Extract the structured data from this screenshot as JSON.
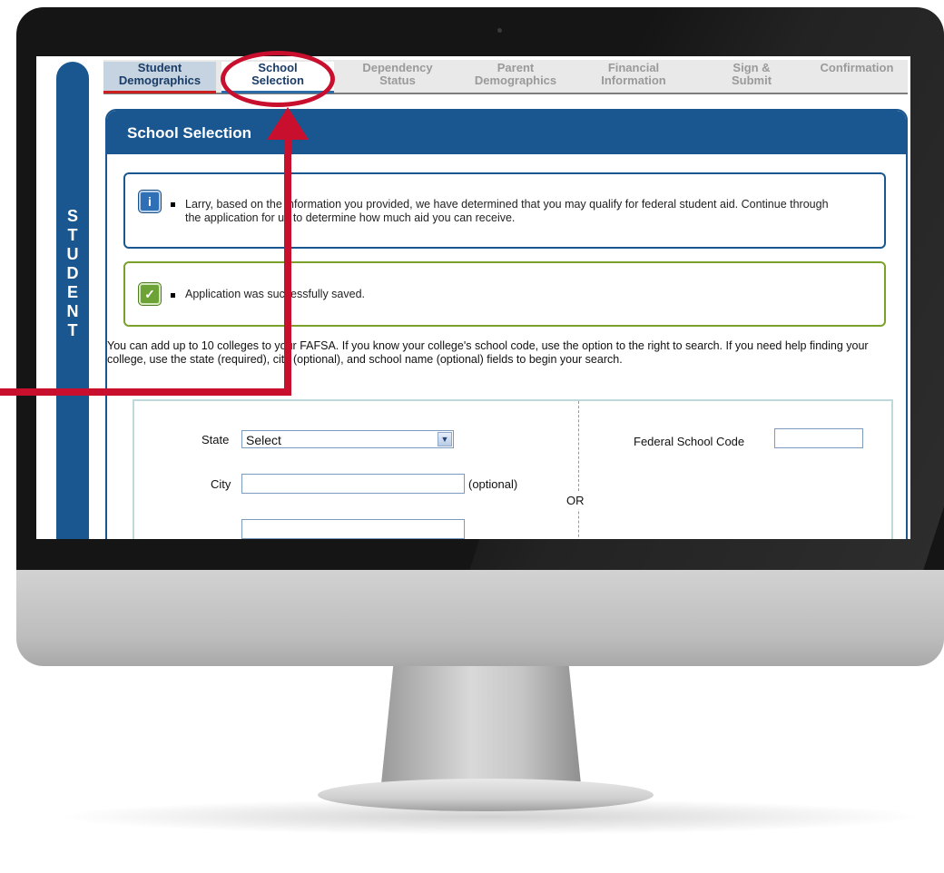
{
  "tabs": [
    {
      "label": "Student\nDemographics",
      "state": "done"
    },
    {
      "label": "School\nSelection",
      "state": "active"
    },
    {
      "label": "Dependency\nStatus",
      "state": "inactive"
    },
    {
      "label": "Parent\nDemographics",
      "state": "inactive"
    },
    {
      "label": "Financial\nInformation",
      "state": "inactive"
    },
    {
      "label": "Sign &\nSubmit",
      "state": "inactive"
    },
    {
      "label": "Confirmation",
      "state": "inactive"
    }
  ],
  "sidebar": {
    "letters": [
      "S",
      "T",
      "U",
      "D",
      "E",
      "N",
      "T"
    ]
  },
  "panel": {
    "title": "School Selection"
  },
  "messages": {
    "info": "Larry, based on the information you provided, we have determined that you may qualify for federal student aid. Continue through the application for us to determine how much aid you can receive.",
    "success": "Application was successfully saved."
  },
  "intro": "You can add up to 10 colleges to your FAFSA. If you know your college's school code, use the option to the right to search. If you need help finding your college, use the state (required), city (optional), and school name (optional) fields to begin your search.",
  "search": {
    "state_label": "State",
    "state_value": "Select",
    "city_label": "City",
    "city_value": "",
    "optional_label": "(optional)",
    "or_label": "OR",
    "code_label": "Federal School Code",
    "code_value": ""
  },
  "colors": {
    "brand_blue": "#1a5790",
    "annotation_red": "#c8102e",
    "success_green": "#7aa22a"
  }
}
